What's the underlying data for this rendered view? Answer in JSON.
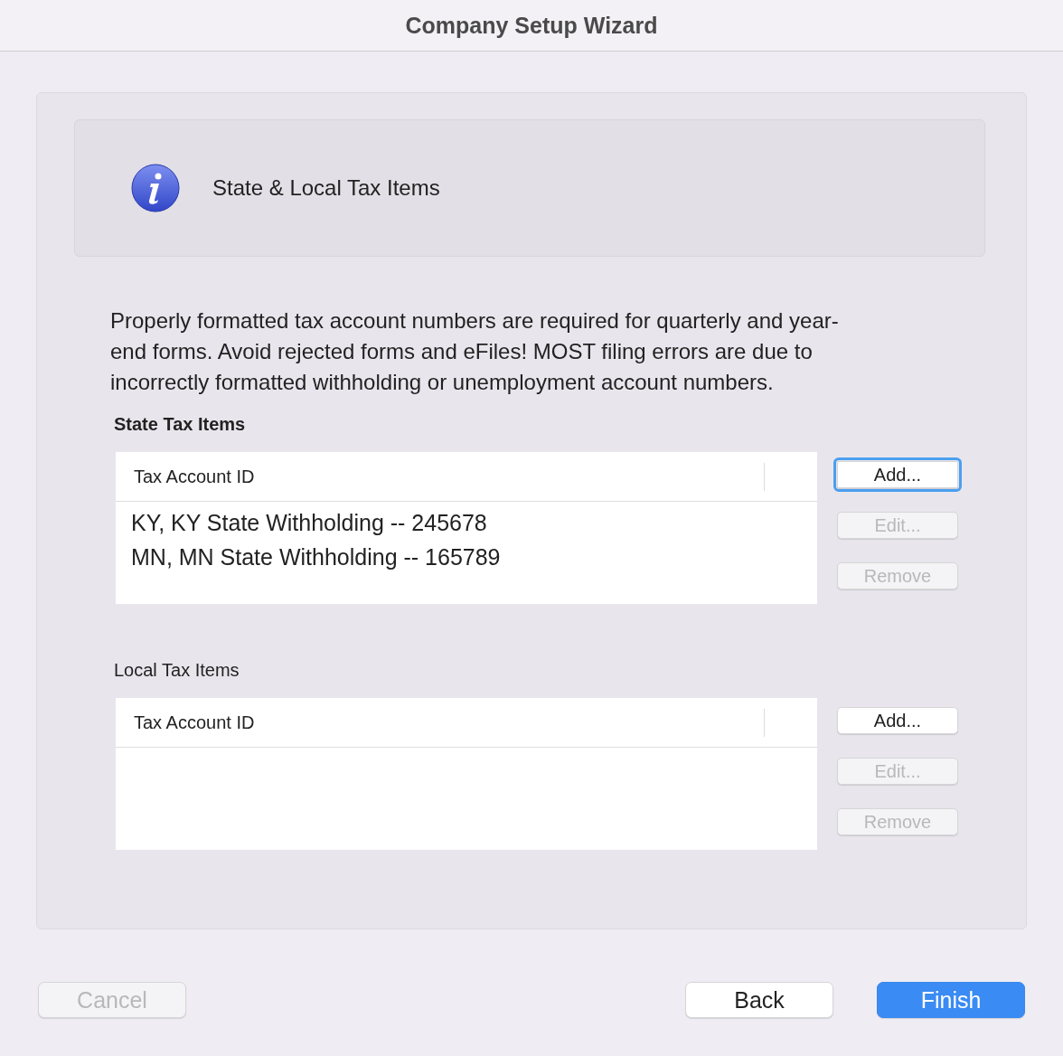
{
  "window": {
    "title": "Company Setup Wizard"
  },
  "header": {
    "title": "State & Local Tax Items"
  },
  "description": "Properly formatted tax account numbers are required for quarterly and year-end forms. Avoid rejected forms and eFiles! MOST filing errors are due to incorrectly formatted withholding or unemployment account numbers.",
  "sections": [
    {
      "label": "State Tax Items",
      "emphasized": true,
      "column": "Tax Account ID",
      "rows": [
        "KY, KY State Withholding -- 245678",
        "MN, MN State Withholding -- 165789"
      ],
      "buttons": [
        {
          "label": "Add...",
          "disabled": false,
          "focused": true
        },
        {
          "label": "Edit...",
          "disabled": true,
          "focused": false
        },
        {
          "label": "Remove",
          "disabled": true,
          "focused": false
        }
      ]
    },
    {
      "label": "Local Tax Items",
      "emphasized": false,
      "column": "Tax Account ID",
      "buttons": [
        {
          "label": "Add...",
          "disabled": false,
          "focused": false
        },
        {
          "label": "Edit...",
          "disabled": true,
          "focused": false
        },
        {
          "label": "Remove",
          "disabled": true,
          "focused": false
        }
      ]
    }
  ],
  "footer": [
    {
      "label": "Cancel",
      "kind": "plain",
      "disabled": true
    },
    {
      "label": "Back",
      "kind": "plain",
      "disabled": false
    },
    {
      "label": "Finish",
      "kind": "primary",
      "disabled": false
    }
  ]
}
